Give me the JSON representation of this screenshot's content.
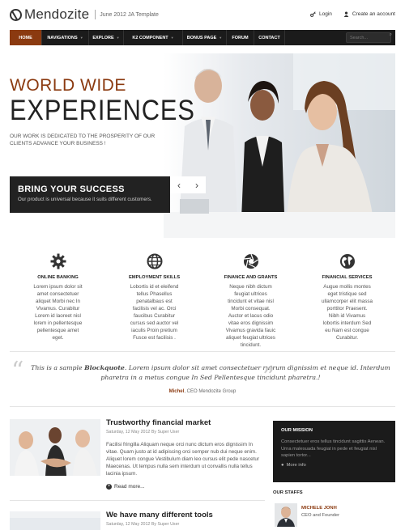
{
  "header": {
    "logo_text": "Mendozite",
    "slogan": "June 2012  JA Template",
    "login_label": "Login",
    "create_account_label": "Create an account"
  },
  "nav": {
    "items": [
      {
        "label": "Home",
        "active": true
      },
      {
        "label": "Navigations",
        "dropdown": true
      },
      {
        "label": "Explore",
        "dropdown": true
      },
      {
        "label": "K2 Component",
        "dropdown": true
      },
      {
        "label": "Bonus Page",
        "dropdown": true
      },
      {
        "label": "Forum"
      },
      {
        "label": "Contact"
      }
    ],
    "search_placeholder": "Search..."
  },
  "hero": {
    "title_line1": "WORLD WIDE",
    "title_line2": "EXPERIENCES",
    "description": "OUR WORK IS DEDICATED TO THE PROSPERITY OF OUR CLIENTS ADVANCE YOUR BUSINESS !",
    "cta_title": "BRING YOUR SUCCESS",
    "cta_subtitle": "Our product is universal because it suits different customers.",
    "prev_arrow": "‹",
    "next_arrow": "›"
  },
  "services": [
    {
      "icon": "gear-icon",
      "title": "Online Banking",
      "text": "Lorem ipsum dolor sit amet consectetuer aliquet Morbi nec In Vivamus. Curabitur Lorem id laoreet nisl lorem in pellentesque pellentesque amet eget."
    },
    {
      "icon": "globe-icon",
      "title": "Employment Skills",
      "text": "Lobortis id et eleifend tellus Phasellus penatalbaus est facilisis vel ac. Orci faucibus Curabitur cursus sed auctor vel iaculis Proin pretium Fusce est facilisis ."
    },
    {
      "icon": "aperture-icon",
      "title": "Finance and Grants",
      "text": "Neque nibh dictum feugiat ultrices tincidunt et vitae nisl Morbi consequat. Auctor et lacus odio vitae eros dignissim Vivamus gravida fauic aliquet feugiat ultrices tincidunt."
    },
    {
      "icon": "world-map-icon",
      "title": "Financial Services",
      "text": "Augue mollis montes eget tristique sed ullamcorper elit massa porttitor Praesent. Nibh id Vivamus lobortis interdum Sed eu Nam est congue Curabitur."
    }
  ],
  "quote": {
    "text_before": "This is a sample ",
    "text_bold": "Blockquote",
    "text_after": ". Lorem ipsum dolor sit amet consectetuer rutrum dignissim et neque id. Interdum pharetra in a metus congue In Sed Pellentesque tincidunt pharetra.!",
    "author_name": "Michel",
    "author_role": ", CEO Mendozite Group"
  },
  "articles": [
    {
      "title": "Trustworthy financial market",
      "meta": "Saturday, 12 May 2012  By Super User",
      "body": "Facilisi fringilla Aliquam neque orci nunc dictum eros dignissim In vitae. Quam justo at id adipiscing orci semper nub dui neque enim. Aliquet lorem congue Vestibulum diam leo cursus elit pede nascetur Maecenas. Ut tempus nulla sem interdum ut convallis nulla tellus lacinia ipsum.",
      "read_more": "Read more..."
    },
    {
      "title": "We have many different tools",
      "meta": "Saturday, 12 May 2012  By Super User"
    }
  ],
  "sidebar": {
    "mission_title": "Our Mission",
    "mission_text": "Consectetuer eros tellus tincidunt sagittis Aenean. Urna malesuada feugiat in pede et feugiat nisl sapien tortor...",
    "mission_more": "More info",
    "staffs_title": "Our Staffs",
    "staff_name": "Michele Jonh",
    "staff_role": "CEO and Founder"
  },
  "colors": {
    "accent": "#8b3a10",
    "dark": "#1b1b1b"
  }
}
